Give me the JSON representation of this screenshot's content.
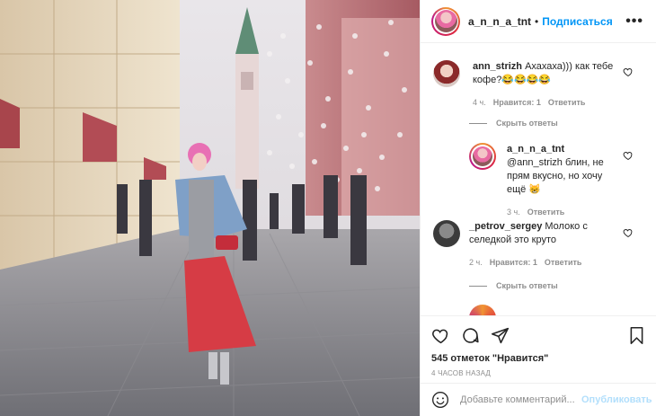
{
  "post": {
    "image_description_icon": "photo-woman-street",
    "author": "a_n_n_a_tnt",
    "separator": "•",
    "follow_label": "Подписаться",
    "more_icon": "more-horizontal-icon"
  },
  "comments": [
    {
      "user": "ann_strizh",
      "text": "Ахахаха))) как тебе кофе?😂😂😂😂",
      "time": "4 ч.",
      "likes": "Нравится: 1",
      "reply": "Ответить"
    },
    {
      "user": "a_n_n_a_tnt",
      "text": "@ann_strizh блин, не прям вкусно, но хочу ещё 😸",
      "time": "3 ч.",
      "reply": "Ответить"
    },
    {
      "user": "_petrov_sergey",
      "text": "Молоко с селедкой это круто",
      "time": "2 ч.",
      "likes": "Нравится: 1",
      "reply": "Ответить"
    }
  ],
  "hide_replies_label": "Скрыть ответы",
  "actions": {
    "like_icon": "heart-icon",
    "comment_icon": "comment-icon",
    "share_icon": "share-icon",
    "save_icon": "bookmark-icon"
  },
  "likes_text": "545 отметок \"Нравится\"",
  "time_ago": "4 ЧАСОВ НАЗАД",
  "add_comment": {
    "placeholder": "Добавьте комментарий...",
    "publish_label": "Опубликовать",
    "emoji_icon": "smiley-icon"
  },
  "colors": {
    "link_blue": "#0095f6",
    "muted_gray": "#8e8e8e",
    "text": "#262626",
    "publish_disabled": "#b2dffc"
  }
}
